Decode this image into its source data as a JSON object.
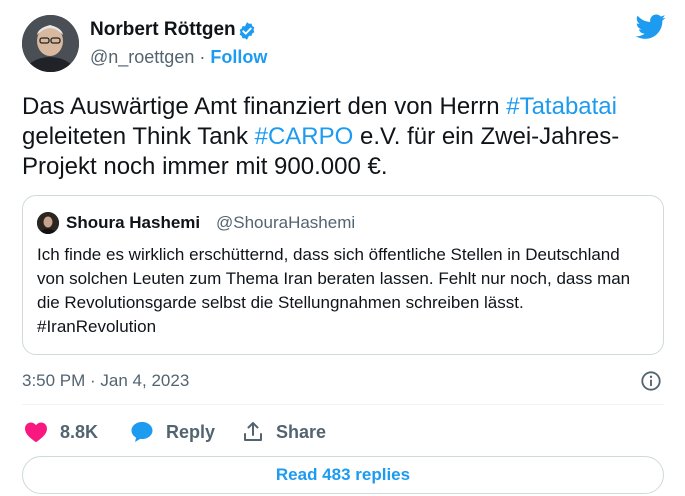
{
  "author": {
    "name": "Norbert Röttgen",
    "handle": "@n_roettgen",
    "separator": " · ",
    "follow_label": "Follow"
  },
  "tweet": {
    "text_parts": [
      {
        "text": "Das Auswärtige Amt finanziert den von Herrn ",
        "hashtag": false
      },
      {
        "text": "#Tatabatai",
        "hashtag": true
      },
      {
        "text": " geleiteten Think Tank ",
        "hashtag": false
      },
      {
        "text": "#CARPO",
        "hashtag": true
      },
      {
        "text": " e.V. für ein Zwei-Jahres-Projekt noch immer mit 900.000 €.",
        "hashtag": false
      }
    ]
  },
  "quote": {
    "name": "Shoura Hashemi",
    "handle": "@ShouraHashemi",
    "text": "Ich finde es wirklich erschütternd, dass sich öffentliche Stellen in Deutschland von solchen Leuten zum Thema Iran beraten lassen. Fehlt nur noch, dass man die Revolutionsgarde selbst die Stellungnahmen schreiben lässt. #IranRevolution"
  },
  "meta": {
    "timestamp": "3:50 PM · Jan 4, 2023"
  },
  "actions": {
    "like_count": "8.8K",
    "reply_label": "Reply",
    "share_label": "Share"
  },
  "read_replies_label": "Read 483 replies",
  "colors": {
    "accent": "#1d9bf0",
    "like": "#f91880",
    "muted": "#536471",
    "border": "#cfd9de"
  }
}
